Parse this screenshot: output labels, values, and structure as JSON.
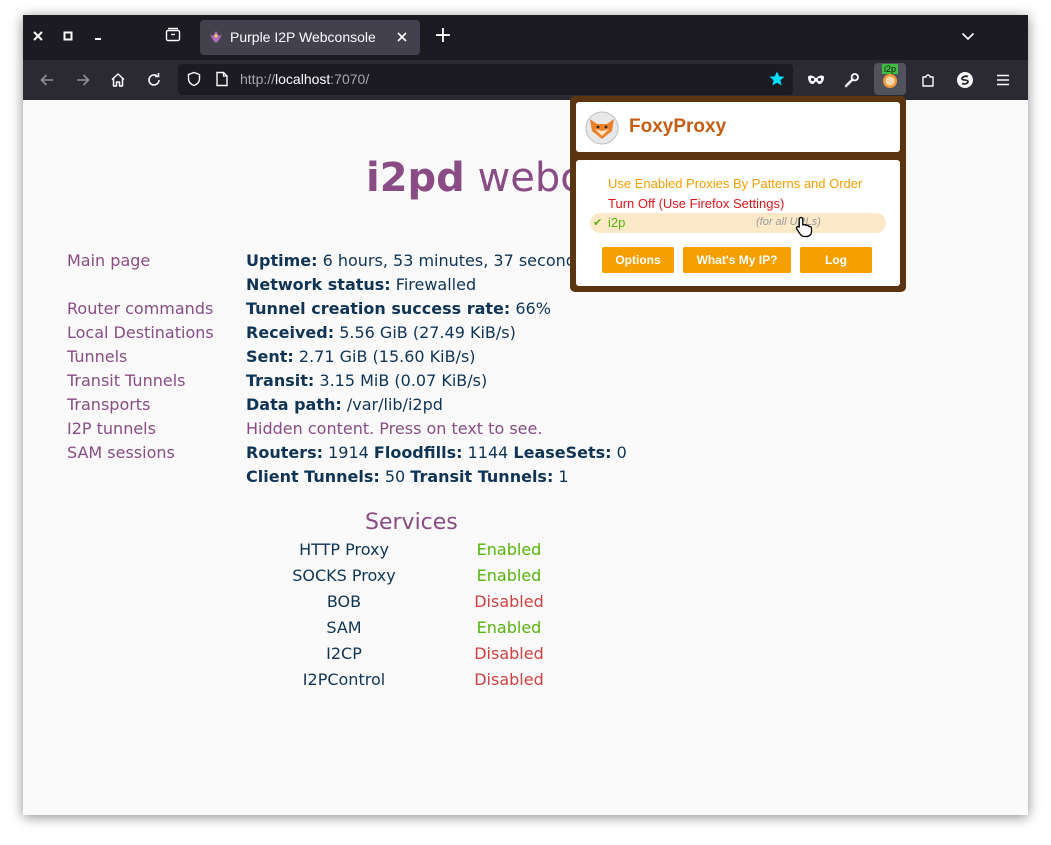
{
  "browser": {
    "tab_title": "Purple I2P Webconsole",
    "url_scheme": "http://",
    "url_host": "localhost",
    "url_rest": ":7070/",
    "new_tab_glyph": "+",
    "extension_badge": "i2p"
  },
  "page": {
    "logo_bold": "i2pd",
    "logo_rest": " webconsole",
    "menu": [
      "Main page",
      "Router commands",
      "Local Destinations",
      "Tunnels",
      "Transit Tunnels",
      "Transports",
      "I2P tunnels",
      "SAM sessions"
    ],
    "stats": {
      "uptime_label": "Uptime:",
      "uptime_value": " 6 hours, 53 minutes, 37 seconds",
      "network_label": "Network status:",
      "network_value": " Firewalled",
      "tunnel_rate_label": "Tunnel creation success rate:",
      "tunnel_rate_value": " 66%",
      "received_label": "Received:",
      "received_value": " 5.56 GiB (27.49 KiB/s)",
      "sent_label": "Sent:",
      "sent_value": " 2.71 GiB (15.60 KiB/s)",
      "transit_label": "Transit:",
      "transit_value": " 3.15 MiB (0.07 KiB/s)",
      "datapath_label": "Data path:",
      "datapath_value": " /var/lib/i2pd",
      "hidden_content": "Hidden content. Press on text to see.",
      "routers_label": "Routers:",
      "routers_value": " 1914 ",
      "floodfills_label": "Floodfills:",
      "floodfills_value": " 1144 ",
      "leasesets_label": "LeaseSets:",
      "leasesets_value": " 0",
      "client_tunnels_label": "Client Tunnels:",
      "client_tunnels_value": " 50 ",
      "transit_tunnels_label": "Transit Tunnels:",
      "transit_tunnels_value": " 1"
    },
    "services_title": "Services",
    "services": [
      {
        "name": "HTTP Proxy",
        "state": "Enabled"
      },
      {
        "name": "SOCKS Proxy",
        "state": "Enabled"
      },
      {
        "name": "BOB",
        "state": "Disabled"
      },
      {
        "name": "SAM",
        "state": "Enabled"
      },
      {
        "name": "I2CP",
        "state": "Disabled"
      },
      {
        "name": "I2PControl",
        "state": "Disabled"
      }
    ]
  },
  "foxyproxy": {
    "title": "FoxyProxy",
    "option_patterns": "Use Enabled Proxies By Patterns and Order",
    "option_off": "Turn Off (Use Firefox Settings)",
    "check_glyph": "✔",
    "active_proxy": "i2p",
    "active_note": "(for all URLs)",
    "btn_options": "Options",
    "btn_whats_my_ip": "What's My IP?",
    "btn_log": "Log"
  },
  "colors": {
    "purple": "#894c84",
    "navy": "#103456",
    "enabled": "#56b40a",
    "disabled": "#d33f3f",
    "foxy_orange": "#f59f00",
    "foxy_brown": "#5b3410"
  }
}
